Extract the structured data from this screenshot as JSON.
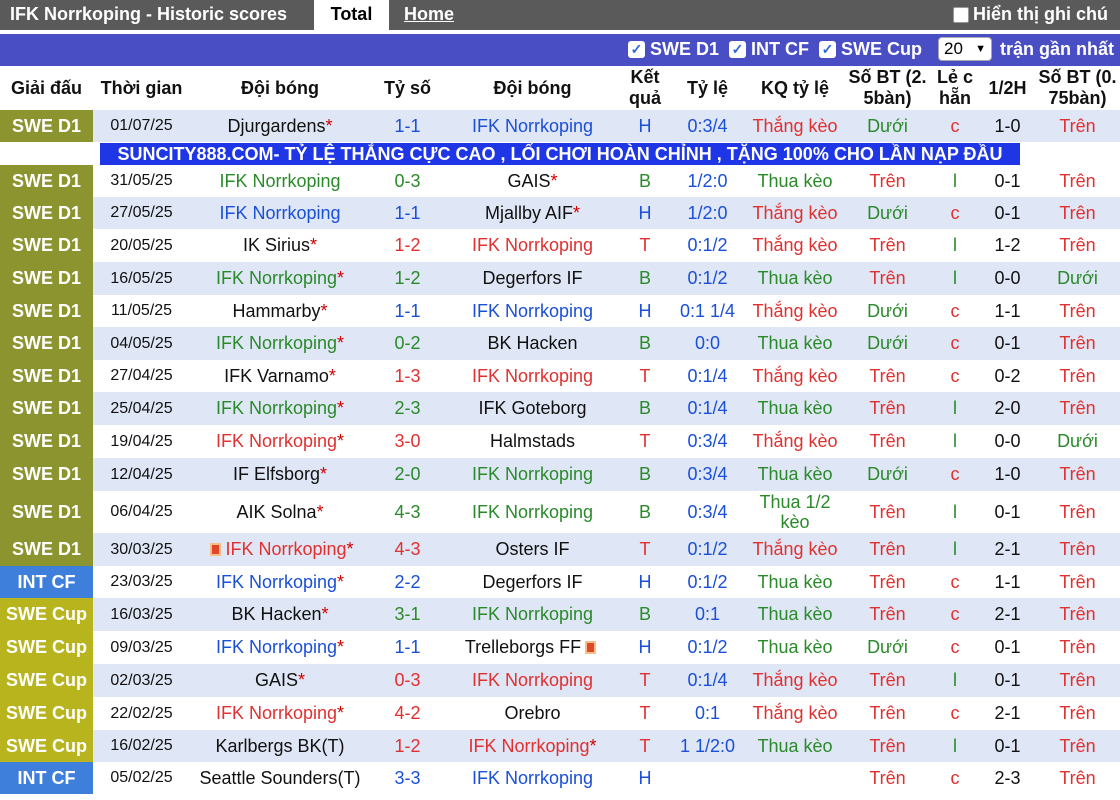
{
  "topbar": {
    "title": "IFK Norrkoping - Historic scores",
    "tab_total": "Total",
    "tab_home": "Home",
    "note_label": "Hiển thị ghi chú"
  },
  "filters": {
    "swe_d1": "SWE D1",
    "int_cf": "INT CF",
    "swe_cup": "SWE Cup",
    "count": "20",
    "recent": "trận gần nhất"
  },
  "headers": [
    "Giải đấu",
    "Thời gian",
    "Đội bóng",
    "Tỷ số",
    "Đội bóng",
    "Kết quả",
    "Tỷ lệ",
    "KQ tỷ lệ",
    "Số BT (2.5bàn)",
    "Lẻ chẵn",
    "1/2H",
    "Số BT (0.75bàn)"
  ],
  "colors": {
    "swe_d1": "#8c9430",
    "int_cf": "#3f7fdc",
    "swe_cup": "#b8b41e",
    "filter_bar": "#4a4ec4",
    "row_a": "#ffffff",
    "row_b": "#dfe6f5"
  },
  "ad": "SUNCITY888.COM- TỶ LỆ THẮNG CỰC CAO , LỐI CHƠI HOÀN CHỈNH , TẶNG 100% CHO LẦN NẠP ĐẦU",
  "rows": [
    {
      "league": "SWE D1",
      "date": "01/07/25",
      "home": "Djurgardens",
      "home_star": "*",
      "score": "1-1",
      "away": "IFK Norrkoping",
      "away_star": "",
      "res": "H",
      "hcap": "0:3/4",
      "hres": "Thắng kèo",
      "ou": "Dưới",
      "oe": "c",
      "ht": "1-0",
      "ou2": "Trên"
    },
    {
      "league": "SWE D1",
      "date": "31/05/25",
      "home": "IFK Norrkoping",
      "home_star": "",
      "score": "0-3",
      "away": "GAIS",
      "away_star": "*",
      "res": "B",
      "hcap": "1/2:0",
      "hres": "Thua kèo",
      "ou": "Trên",
      "oe": "l",
      "ht": "0-1",
      "ou2": "Trên"
    },
    {
      "league": "SWE D1",
      "date": "27/05/25",
      "home": "IFK Norrkoping",
      "home_star": "",
      "score": "1-1",
      "away": "Mjallby AIF",
      "away_star": "*",
      "res": "H",
      "hcap": "1/2:0",
      "hres": "Thắng kèo",
      "ou": "Dưới",
      "oe": "c",
      "ht": "0-1",
      "ou2": "Trên"
    },
    {
      "league": "SWE D1",
      "date": "20/05/25",
      "home": "IK Sirius",
      "home_star": "*",
      "score": "1-2",
      "away": "IFK Norrkoping",
      "away_star": "",
      "res": "T",
      "hcap": "0:1/2",
      "hres": "Thắng kèo",
      "ou": "Trên",
      "oe": "l",
      "ht": "1-2",
      "ou2": "Trên"
    },
    {
      "league": "SWE D1",
      "date": "16/05/25",
      "home": "IFK Norrkoping",
      "home_star": "*",
      "score": "1-2",
      "away": "Degerfors IF",
      "away_star": "",
      "res": "B",
      "hcap": "0:1/2",
      "hres": "Thua kèo",
      "ou": "Trên",
      "oe": "l",
      "ht": "0-0",
      "ou2": "Dưới"
    },
    {
      "league": "SWE D1",
      "date": "11/05/25",
      "home": "Hammarby",
      "home_star": "*",
      "score": "1-1",
      "away": "IFK Norrkoping",
      "away_star": "",
      "res": "H",
      "hcap": "0:1 1/4",
      "hres": "Thắng kèo",
      "ou": "Dưới",
      "oe": "c",
      "ht": "1-1",
      "ou2": "Trên"
    },
    {
      "league": "SWE D1",
      "date": "04/05/25",
      "home": "IFK Norrkoping",
      "home_star": "*",
      "score": "0-2",
      "away": "BK Hacken",
      "away_star": "",
      "res": "B",
      "hcap": "0:0",
      "hres": "Thua kèo",
      "ou": "Dưới",
      "oe": "c",
      "ht": "0-1",
      "ou2": "Trên"
    },
    {
      "league": "SWE D1",
      "date": "27/04/25",
      "home": "IFK Varnamo",
      "home_star": "*",
      "score": "1-3",
      "away": "IFK Norrkoping",
      "away_star": "",
      "res": "T",
      "hcap": "0:1/4",
      "hres": "Thắng kèo",
      "ou": "Trên",
      "oe": "c",
      "ht": "0-2",
      "ou2": "Trên"
    },
    {
      "league": "SWE D1",
      "date": "25/04/25",
      "home": "IFK Norrkoping",
      "home_star": "*",
      "score": "2-3",
      "away": "IFK Goteborg",
      "away_star": "",
      "res": "B",
      "hcap": "0:1/4",
      "hres": "Thua kèo",
      "ou": "Trên",
      "oe": "l",
      "ht": "2-0",
      "ou2": "Trên"
    },
    {
      "league": "SWE D1",
      "date": "19/04/25",
      "home": "IFK Norrkoping",
      "home_star": "*",
      "score": "3-0",
      "away": "Halmstads",
      "away_star": "",
      "res": "T",
      "hcap": "0:3/4",
      "hres": "Thắng kèo",
      "ou": "Trên",
      "oe": "l",
      "ht": "0-0",
      "ou2": "Dưới"
    },
    {
      "league": "SWE D1",
      "date": "12/04/25",
      "home": "IF Elfsborg",
      "home_star": "*",
      "score": "2-0",
      "away": "IFK Norrkoping",
      "away_star": "",
      "res": "B",
      "hcap": "0:3/4",
      "hres": "Thua kèo",
      "ou": "Dưới",
      "oe": "c",
      "ht": "1-0",
      "ou2": "Trên"
    },
    {
      "league": "SWE D1",
      "date": "06/04/25",
      "home": "AIK Solna",
      "home_star": "*",
      "score": "4-3",
      "away": "IFK Norrkoping",
      "away_star": "",
      "res": "B",
      "hcap": "0:3/4",
      "hres": "Thua 1/2 kèo",
      "ou": "Trên",
      "oe": "l",
      "ht": "0-1",
      "ou2": "Trên"
    },
    {
      "league": "SWE D1",
      "date": "30/03/25",
      "home": "IFK Norrkoping",
      "home_star": "*",
      "score": "4-3",
      "away": "Osters IF",
      "away_star": "",
      "res": "T",
      "hcap": "0:1/2",
      "hres": "Thắng kèo",
      "ou": "Trên",
      "oe": "l",
      "ht": "2-1",
      "ou2": "Trên"
    },
    {
      "league": "INT CF",
      "date": "23/03/25",
      "home": "IFK Norrkoping",
      "home_star": "*",
      "score": "2-2",
      "away": "Degerfors IF",
      "away_star": "",
      "res": "H",
      "hcap": "0:1/2",
      "hres": "Thua kèo",
      "ou": "Trên",
      "oe": "c",
      "ht": "1-1",
      "ou2": "Trên"
    },
    {
      "league": "SWE Cup",
      "date": "16/03/25",
      "home": "BK Hacken",
      "home_star": "*",
      "score": "3-1",
      "away": "IFK Norrkoping",
      "away_star": "",
      "res": "B",
      "hcap": "0:1",
      "hres": "Thua kèo",
      "ou": "Trên",
      "oe": "c",
      "ht": "2-1",
      "ou2": "Trên"
    },
    {
      "league": "SWE Cup",
      "date": "09/03/25",
      "home": "IFK Norrkoping",
      "home_star": "*",
      "score": "1-1",
      "away": "Trelleborgs FF",
      "away_star": "",
      "res": "H",
      "hcap": "0:1/2",
      "hres": "Thua kèo",
      "ou": "Dưới",
      "oe": "c",
      "ht": "0-1",
      "ou2": "Trên"
    },
    {
      "league": "SWE Cup",
      "date": "02/03/25",
      "home": "GAIS",
      "home_star": "*",
      "score": "0-3",
      "away": "IFK Norrkoping",
      "away_star": "",
      "res": "T",
      "hcap": "0:1/4",
      "hres": "Thắng kèo",
      "ou": "Trên",
      "oe": "l",
      "ht": "0-1",
      "ou2": "Trên"
    },
    {
      "league": "SWE Cup",
      "date": "22/02/25",
      "home": "IFK Norrkoping",
      "home_star": "*",
      "score": "4-2",
      "away": "Orebro",
      "away_star": "",
      "res": "T",
      "hcap": "0:1",
      "hres": "Thắng kèo",
      "ou": "Trên",
      "oe": "c",
      "ht": "2-1",
      "ou2": "Trên"
    },
    {
      "league": "SWE Cup",
      "date": "16/02/25",
      "home": "Karlbergs BK(T)",
      "home_star": "",
      "score": "1-2",
      "away": "IFK Norrkoping",
      "away_star": "*",
      "res": "T",
      "hcap": "1 1/2:0",
      "hres": "Thua kèo",
      "ou": "Trên",
      "oe": "l",
      "ht": "0-1",
      "ou2": "Trên"
    },
    {
      "league": "INT CF",
      "date": "05/02/25",
      "home": "Seattle Sounders(T)",
      "home_star": "",
      "score": "3-3",
      "away": "IFK Norrkoping",
      "away_star": "",
      "res": "H",
      "hcap": "",
      "hres": "",
      "ou": "Trên",
      "oe": "c",
      "ht": "2-3",
      "ou2": "Trên"
    }
  ]
}
